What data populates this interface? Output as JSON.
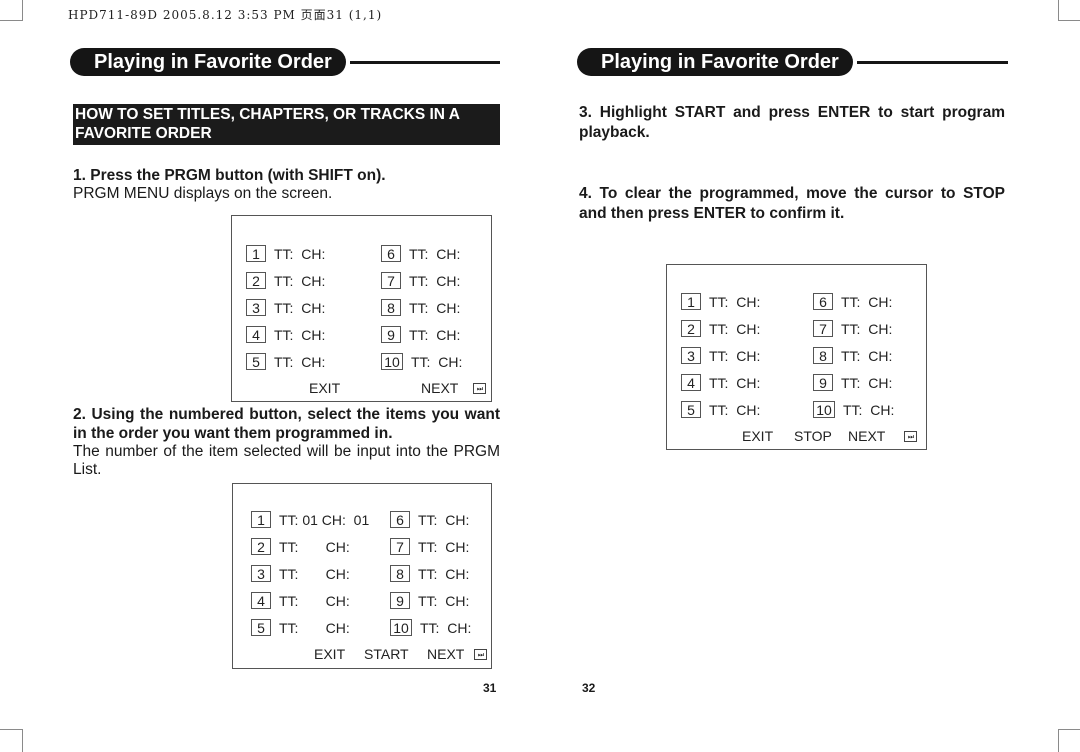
{
  "print_header": "HPD711-89D  2005.8.12  3:53 PM  页面31 (1,1)",
  "left_page": {
    "section_title": "Playing in Favorite Order",
    "banner": "HOW TO SET TITLES, CHAPTERS, OR TRACKS IN A FAVORITE ORDER",
    "step1": {
      "heading": "1. Press the PRGM button (with SHIFT on).",
      "body": "PRGM MENU displays on the screen."
    },
    "menu1": {
      "rows": [
        {
          "n": "1",
          "text": "TT:  CH:"
        },
        {
          "n": "2",
          "text": "TT:  CH:"
        },
        {
          "n": "3",
          "text": "TT:  CH:"
        },
        {
          "n": "4",
          "text": "TT:  CH:"
        },
        {
          "n": "5",
          "text": "TT:  CH:"
        },
        {
          "n": "6",
          "text": "TT:  CH:"
        },
        {
          "n": "7",
          "text": "TT:  CH:"
        },
        {
          "n": "8",
          "text": "TT:  CH:"
        },
        {
          "n": "9",
          "text": "TT:  CH:"
        },
        {
          "n": "10",
          "text": "TT:  CH:"
        }
      ],
      "exit": "EXIT",
      "next": "NEXT",
      "skip_icon": "⏭"
    },
    "step2": {
      "heading": "2. Using the numbered button, select the items you want in the order you want them programmed in.",
      "body": "The number of the item selected will be input into the PRGM List."
    },
    "menu2": {
      "rows": [
        {
          "n": "1",
          "text": "TT: 01 CH:  01"
        },
        {
          "n": "2",
          "text": "TT:       CH:"
        },
        {
          "n": "3",
          "text": "TT:       CH:"
        },
        {
          "n": "4",
          "text": "TT:       CH:"
        },
        {
          "n": "5",
          "text": "TT:       CH:"
        },
        {
          "n": "6",
          "text": "TT:  CH:"
        },
        {
          "n": "7",
          "text": "TT:  CH:"
        },
        {
          "n": "8",
          "text": "TT:  CH:"
        },
        {
          "n": "9",
          "text": "TT:  CH:"
        },
        {
          "n": "10",
          "text": "TT:  CH:"
        }
      ],
      "exit": "EXIT",
      "start": "START",
      "next": "NEXT",
      "skip_icon": "⏭"
    },
    "page_number": "31"
  },
  "right_page": {
    "section_title": "Playing in Favorite Order",
    "step3": "3. Highlight START and press ENTER to start program playback.",
    "step4": "4.  To clear the programmed, move the cursor to STOP and then press ENTER to confirm it.",
    "menu3": {
      "rows": [
        {
          "n": "1",
          "text": "TT:  CH:"
        },
        {
          "n": "2",
          "text": "TT:  CH:"
        },
        {
          "n": "3",
          "text": "TT:  CH:"
        },
        {
          "n": "4",
          "text": "TT:  CH:"
        },
        {
          "n": "5",
          "text": "TT:  CH:"
        },
        {
          "n": "6",
          "text": "TT:  CH:"
        },
        {
          "n": "7",
          "text": "TT:  CH:"
        },
        {
          "n": "8",
          "text": "TT:  CH:"
        },
        {
          "n": "9",
          "text": "TT:  CH:"
        },
        {
          "n": "10",
          "text": "TT:  CH:"
        }
      ],
      "exit": "EXIT",
      "stop": "STOP",
      "next": "NEXT",
      "skip_icon": "⏭"
    },
    "page_number": "32"
  }
}
